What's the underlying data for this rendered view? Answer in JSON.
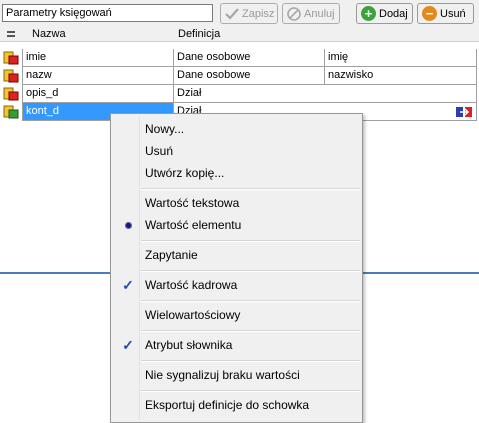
{
  "toolbar": {
    "title_value": "Parametry księgowań",
    "save_label": "Zapisz",
    "cancel_label": "Anuluj",
    "add_label": "Dodaj",
    "delete_label": "Usuń"
  },
  "table": {
    "columns": [
      "Nazwa",
      "Definicja"
    ],
    "rows": [
      {
        "name": "imie",
        "definition": "Dane osobowe",
        "extra": "imię"
      },
      {
        "name": "nazw",
        "definition": "Dane osobowe",
        "extra": "nazwisko"
      },
      {
        "name": "opis_d",
        "definition": "Dział",
        "extra": ""
      },
      {
        "name": "kont_d",
        "definition": "Dział",
        "extra": ""
      }
    ]
  },
  "context_menu": {
    "items": [
      {
        "label": "Nowy...",
        "mark": ""
      },
      {
        "label": "Usuń",
        "mark": ""
      },
      {
        "label": "Utwórz kopię...",
        "mark": ""
      },
      {
        "label": "Wartość tekstowa",
        "mark": ""
      },
      {
        "label": "Wartość elementu",
        "mark": "radio"
      },
      {
        "label": "Zapytanie",
        "mark": ""
      },
      {
        "label": "Wartość kadrowa",
        "mark": "check"
      },
      {
        "label": "Wielowartościowy",
        "mark": ""
      },
      {
        "label": "Atrybut słownika",
        "mark": "check"
      },
      {
        "label": "Nie sygnalizuj braku wartości",
        "mark": ""
      },
      {
        "label": "Eksportuj definicje do schowka",
        "mark": ""
      }
    ]
  },
  "colors": {
    "selection": "#3399ff",
    "add_green": "#3aa33a",
    "delete_orange": "#e08a1e"
  }
}
